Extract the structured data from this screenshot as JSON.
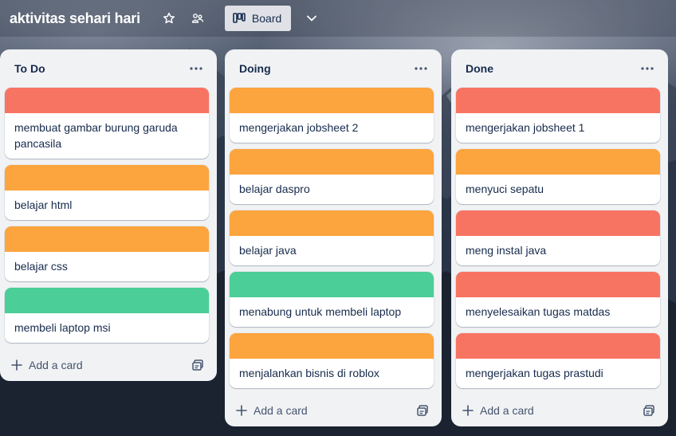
{
  "header": {
    "board_title": "aktivitas sehari hari",
    "view_label": "Board",
    "star_icon": "star-icon",
    "visibility_icon": "workspace-visibility-icon",
    "view_icon": "board-view-icon",
    "chevron_icon": "chevron-down-icon"
  },
  "colors": {
    "red": "#f87462",
    "orange": "#fca43d",
    "green": "#4bce97",
    "list_bg": "#f1f2f4",
    "text": "#172b4d"
  },
  "lists": [
    {
      "title": "To Do",
      "add_card_label": "Add a card",
      "cards": [
        {
          "text": "membuat gambar burung garuda pancasila",
          "cover": "#f87462"
        },
        {
          "text": "belajar html",
          "cover": "#fca43d"
        },
        {
          "text": "belajar css",
          "cover": "#fca43d"
        },
        {
          "text": "membeli laptop msi",
          "cover": "#4bce97"
        }
      ]
    },
    {
      "title": "Doing",
      "add_card_label": "Add a card",
      "cards": [
        {
          "text": "mengerjakan jobsheet 2",
          "cover": "#fca43d"
        },
        {
          "text": "belajar daspro",
          "cover": "#fca43d"
        },
        {
          "text": "belajar java",
          "cover": "#fca43d"
        },
        {
          "text": "menabung untuk membeli laptop",
          "cover": "#4bce97"
        },
        {
          "text": "menjalankan bisnis di roblox",
          "cover": "#fca43d"
        }
      ]
    },
    {
      "title": "Done",
      "add_card_label": "Add a card",
      "cards": [
        {
          "text": "mengerjakan jobsheet 1",
          "cover": "#f87462"
        },
        {
          "text": "menyuci sepatu",
          "cover": "#fca43d"
        },
        {
          "text": "meng instal java",
          "cover": "#f87462"
        },
        {
          "text": "menyelesaikan tugas matdas",
          "cover": "#f87462"
        },
        {
          "text": "mengerjakan tugas prastudi",
          "cover": "#f87462"
        }
      ]
    }
  ]
}
